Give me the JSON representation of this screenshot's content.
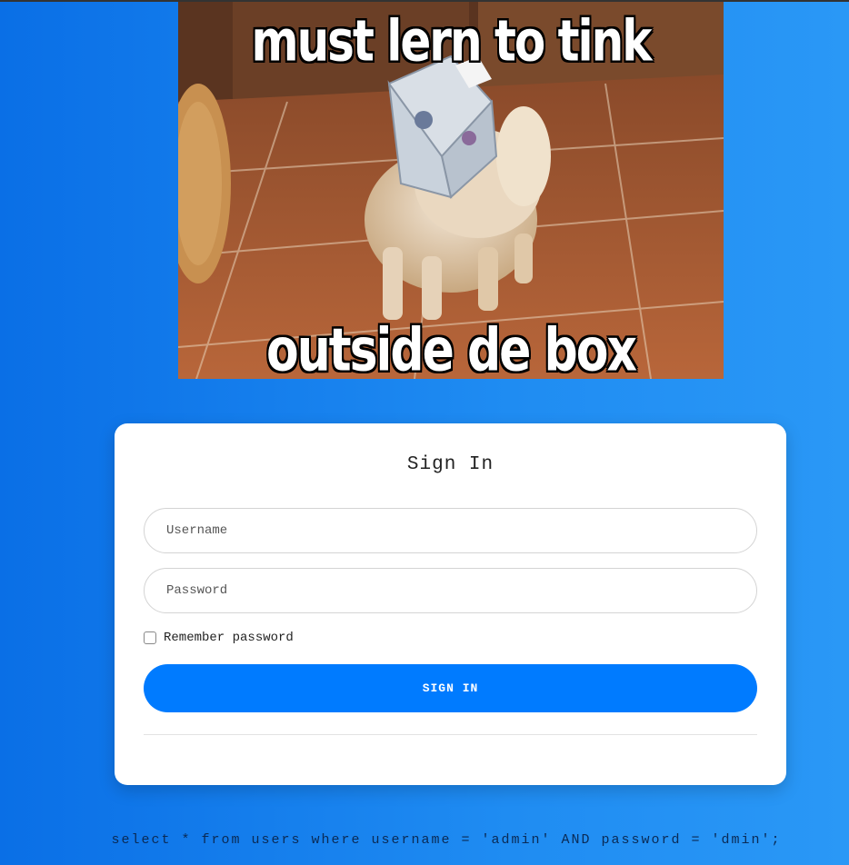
{
  "meme": {
    "top_text": "must lern to tink",
    "bottom_text": "outside de box",
    "icon": "dog-with-tissue-box-on-head"
  },
  "login": {
    "title": "Sign In",
    "username_placeholder": "Username",
    "password_placeholder": "Password",
    "remember_label": "Remember password",
    "remember_checked": false,
    "submit_label": "SIGN IN"
  },
  "debug": {
    "query": "select * from users where username = 'admin' AND password = 'dmin';"
  },
  "colors": {
    "background_start": "#0a6fe6",
    "background_end": "#2a98f6",
    "button": "#007bff",
    "card": "#ffffff"
  }
}
